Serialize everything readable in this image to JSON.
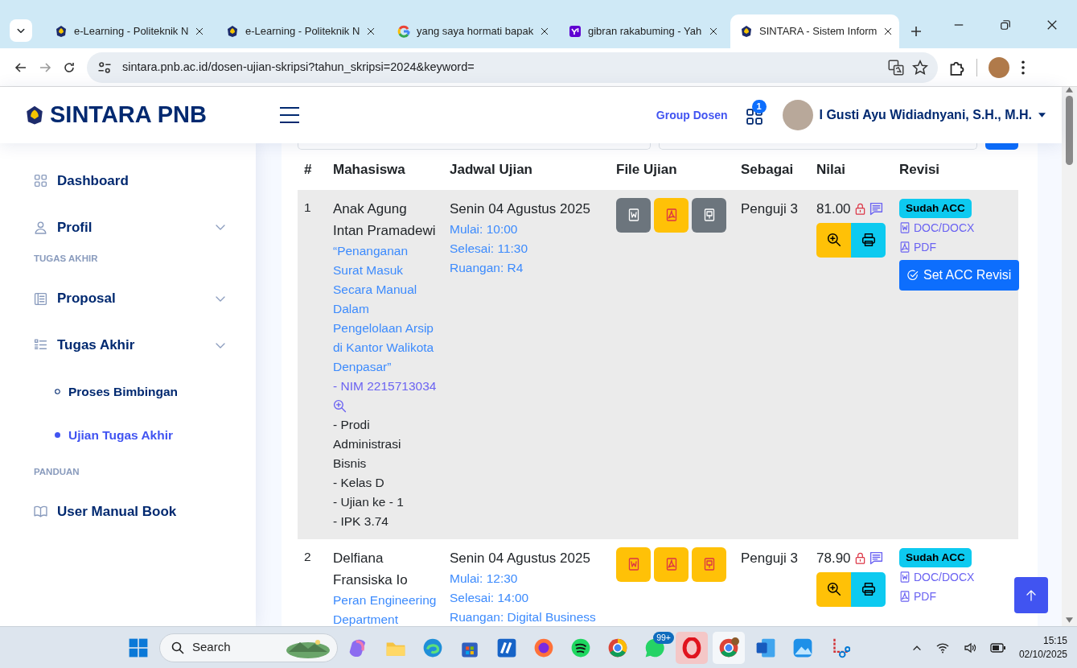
{
  "browser": {
    "tabs": [
      {
        "kind": "emblem",
        "title": "e-Learning - Politeknik N",
        "selected": false
      },
      {
        "kind": "emblem",
        "title": "e-Learning - Politeknik N",
        "selected": false
      },
      {
        "kind": "ring",
        "title": "yang saya hormati bapak",
        "selected": false
      },
      {
        "kind": "square",
        "title": "gibran rakabuming - Yah",
        "selected": false
      },
      {
        "kind": "emblem",
        "title": "SINTARA - Sistem Inform",
        "selected": true
      }
    ],
    "url": "sintara.pnb.ac.id/dosen-ujian-skripsi?tahun_skripsi=2024&keyword="
  },
  "app_header": {
    "brand": "SINTARA PNB",
    "group_link": "Group Dosen",
    "notification_count": "1",
    "user_name": "I Gusti Ayu Widiadnyani, S.H., M.H."
  },
  "sidebar": {
    "items": [
      {
        "kind": "link",
        "label": "Dashboard"
      },
      {
        "kind": "dropdown",
        "label": "Profil"
      },
      {
        "kind": "heading",
        "label": "TUGAS AKHIR"
      },
      {
        "kind": "dropdown",
        "label": "Proposal"
      },
      {
        "kind": "dropdown",
        "label": "Tugas Akhir",
        "children": [
          {
            "label": "Proses Bimbingan",
            "selected": false
          },
          {
            "label": "Ujian Tugas Akhir",
            "selected": true
          }
        ]
      },
      {
        "kind": "heading",
        "label": "PANDUAN"
      },
      {
        "kind": "link",
        "label": "User Manual Book"
      }
    ]
  },
  "table": {
    "columns": [
      "#",
      "Mahasiswa",
      "Jadwal Ujian",
      "File Ujian",
      "Sebagai",
      "Nilai",
      "Revisi"
    ],
    "rows": [
      {
        "no": "1",
        "name": "Anak Agung Intan Pramadewi",
        "title": "“Penanganan Surat Masuk Secara Manual Dalam Pengelolaan Arsip di Kantor Walikota Denpasar”",
        "nim": "- NIM 2215713034",
        "details": [
          "- Prodi Administrasi Bisnis",
          "- Kelas D",
          "- Ujian ke - 1",
          "- IPK 3.74"
        ],
        "date": "Senin 04 Agustus 2025",
        "schedule": [
          "Mulai: 10:00",
          "Selesai: 11:30",
          "Ruangan: R4"
        ],
        "files": [
          {
            "kind": "word",
            "available": false
          },
          {
            "kind": "pdf",
            "available": true
          },
          {
            "kind": "slides",
            "available": false
          }
        ],
        "role": "Penguji 3",
        "score": "81.00",
        "locked": true,
        "revision_status": "Sudah ACC",
        "revision_files": [
          "DOC/DOCX",
          "PDF"
        ],
        "action": "Set ACC Revisi"
      },
      {
        "no": "2",
        "name": "Delfiana Fransiska Io",
        "title": "Peran Engineering Department",
        "date": "Senin 04 Agustus 2025",
        "schedule": [
          "Mulai: 12:30",
          "Selesai: 14:00",
          "Ruangan: Digital Business"
        ],
        "files": [
          {
            "kind": "word",
            "available": true
          },
          {
            "kind": "pdf",
            "available": true
          },
          {
            "kind": "slides",
            "available": true
          }
        ],
        "role": "Penguji 3",
        "score": "78.90",
        "locked": true,
        "revision_status": "Sudah ACC",
        "revision_files": [
          "DOC/DOCX",
          "PDF"
        ]
      }
    ]
  },
  "taskbar": {
    "search": {
      "placeholder": "Search"
    },
    "chat_badge": "99+",
    "time": "15:15",
    "date": "02/10/2025"
  }
}
